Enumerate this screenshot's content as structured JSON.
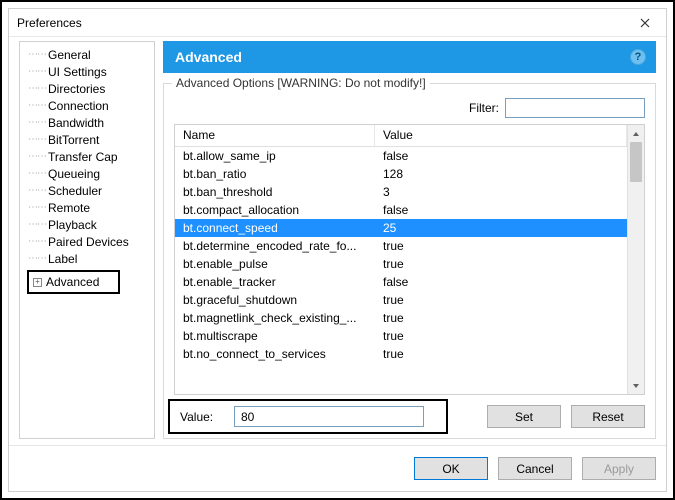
{
  "window": {
    "title": "Preferences"
  },
  "sidebar": {
    "items": [
      {
        "label": "General"
      },
      {
        "label": "UI Settings"
      },
      {
        "label": "Directories"
      },
      {
        "label": "Connection"
      },
      {
        "label": "Bandwidth"
      },
      {
        "label": "BitTorrent"
      },
      {
        "label": "Transfer Cap"
      },
      {
        "label": "Queueing"
      },
      {
        "label": "Scheduler"
      },
      {
        "label": "Remote"
      },
      {
        "label": "Playback"
      },
      {
        "label": "Paired Devices"
      },
      {
        "label": "Label"
      }
    ],
    "advanced_label": "Advanced"
  },
  "main": {
    "header": "Advanced",
    "group_title": "Advanced Options [WARNING: Do not modify!]",
    "filter_label": "Filter:",
    "filter_value": "",
    "columns": {
      "name": "Name",
      "value": "Value"
    },
    "rows": [
      {
        "name": "bt.allow_same_ip",
        "value": "false",
        "selected": false
      },
      {
        "name": "bt.ban_ratio",
        "value": "128",
        "selected": false
      },
      {
        "name": "bt.ban_threshold",
        "value": "3",
        "selected": false
      },
      {
        "name": "bt.compact_allocation",
        "value": "false",
        "selected": false
      },
      {
        "name": "bt.connect_speed",
        "value": "25",
        "selected": true
      },
      {
        "name": "bt.determine_encoded_rate_fo...",
        "value": "true",
        "selected": false
      },
      {
        "name": "bt.enable_pulse",
        "value": "true",
        "selected": false
      },
      {
        "name": "bt.enable_tracker",
        "value": "false",
        "selected": false
      },
      {
        "name": "bt.graceful_shutdown",
        "value": "true",
        "selected": false
      },
      {
        "name": "bt.magnetlink_check_existing_...",
        "value": "true",
        "selected": false
      },
      {
        "name": "bt.multiscrape",
        "value": "true",
        "selected": false
      },
      {
        "name": "bt.no_connect_to_services",
        "value": "true",
        "selected": false
      }
    ],
    "value_label": "Value:",
    "value_input": "80",
    "set_btn": "Set",
    "reset_btn": "Reset"
  },
  "footer": {
    "ok": "OK",
    "cancel": "Cancel",
    "apply": "Apply"
  }
}
